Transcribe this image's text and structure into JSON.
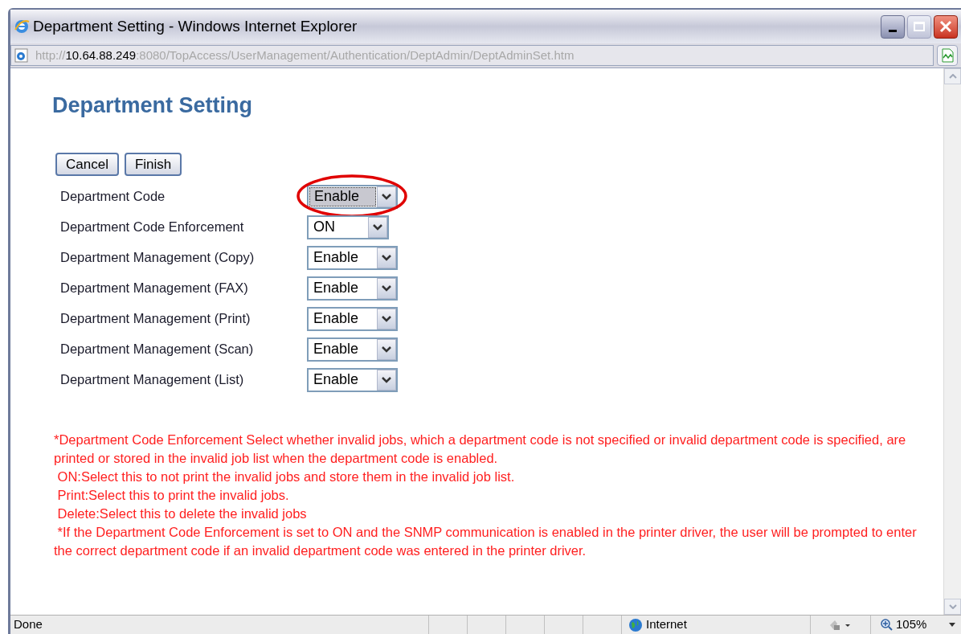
{
  "window": {
    "title": "Department Setting - Windows Internet Explorer"
  },
  "address": {
    "scheme": "http://",
    "host": "10.64.88.249",
    "path": ":8080/TopAccess/UserManagement/Authentication/DeptAdmin/DeptAdminSet.htm"
  },
  "page": {
    "heading": "Department Setting",
    "buttons": [
      "Cancel",
      "Finish"
    ],
    "settings": [
      {
        "label": "Department Code",
        "value": "Enable",
        "focused": true,
        "highlighted": true
      },
      {
        "label": "Department Code Enforcement",
        "value": "ON",
        "focused": false,
        "highlighted": false
      },
      {
        "label": "Department Management (Copy)",
        "value": "Enable",
        "focused": false,
        "highlighted": false
      },
      {
        "label": "Department Management (FAX)",
        "value": "Enable",
        "focused": false,
        "highlighted": false
      },
      {
        "label": "Department Management (Print)",
        "value": "Enable",
        "focused": false,
        "highlighted": false
      },
      {
        "label": "Department Management (Scan)",
        "value": "Enable",
        "focused": false,
        "highlighted": false
      },
      {
        "label": "Department Management (List)",
        "value": "Enable",
        "focused": false,
        "highlighted": false
      }
    ],
    "notes": [
      "*Department Code Enforcement Select whether invalid jobs, which a department code is not specified or invalid department code is specified, are printed or stored in the invalid job list when the department code is enabled.",
      " ON:Select this to not print the invalid jobs and store them in the invalid job list.",
      " Print:Select this to print the invalid jobs.",
      " Delete:Select this to delete the invalid jobs",
      " *If the Department Code Enforcement is set to ON and the SNMP communication is enabled in the printer driver, the user will be prompted to enter the correct department code if an invalid department code was entered in the printer driver."
    ]
  },
  "status_bar": {
    "text": "Done",
    "zone": "Internet",
    "zoom": "105%"
  }
}
